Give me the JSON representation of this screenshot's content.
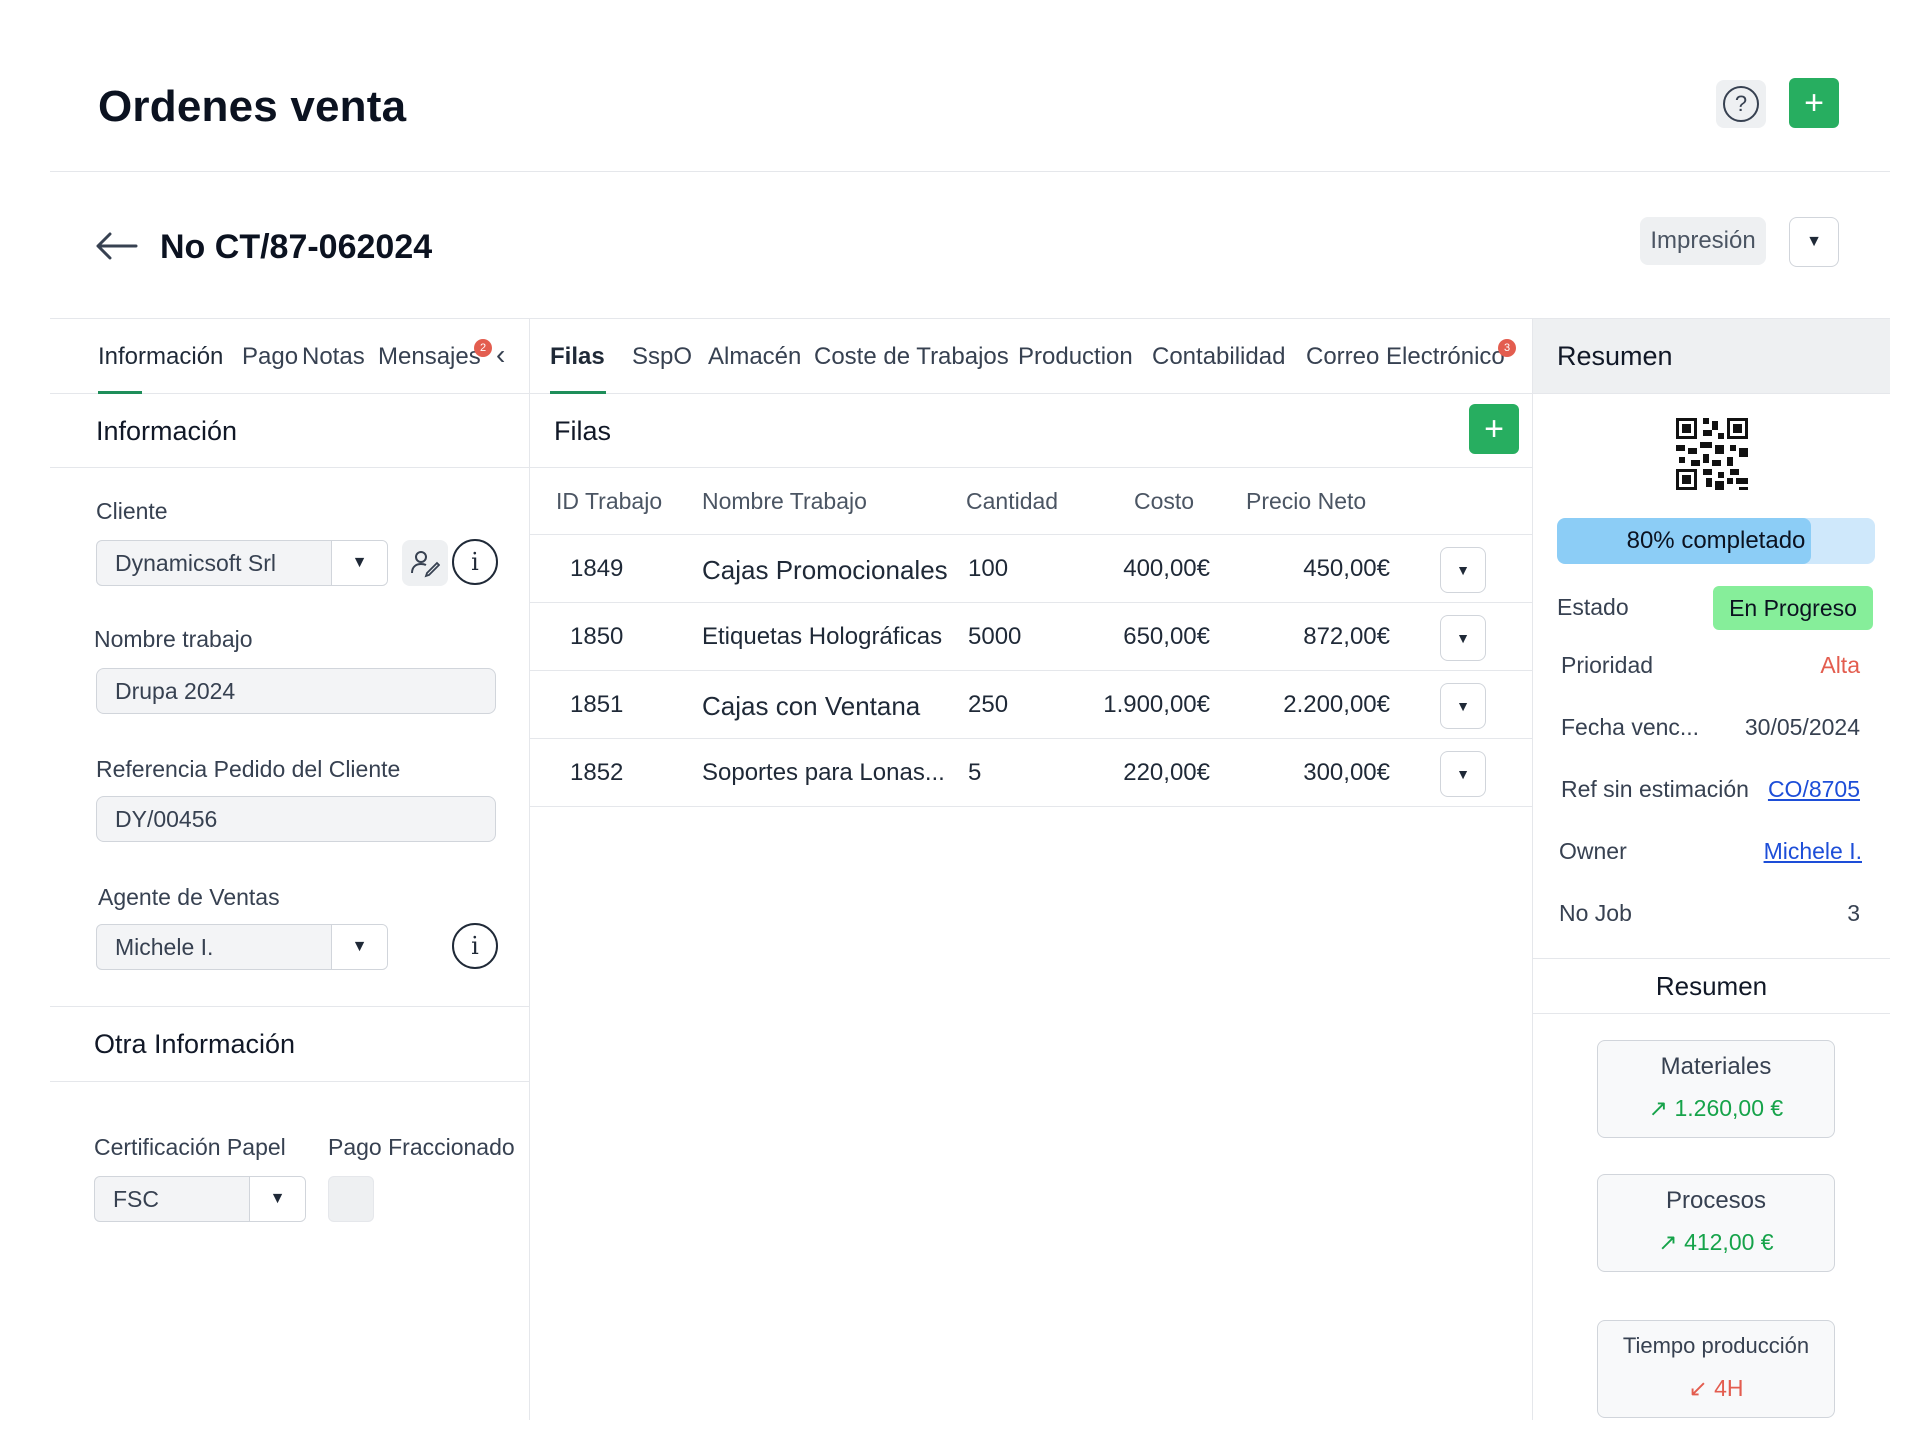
{
  "header": {
    "title": "Ordenes venta",
    "help_glyph": "?",
    "add_glyph": "+"
  },
  "order": {
    "number": "No CT/87-062024",
    "print_label": "Impresión"
  },
  "left_tabs": [
    {
      "label": "Información",
      "active": true
    },
    {
      "label": "Pago"
    },
    {
      "label": "Notas"
    },
    {
      "label": "Mensajes",
      "badge": "2"
    }
  ],
  "left": {
    "section_info": "Información",
    "cliente_label": "Cliente",
    "cliente_value": "Dynamicsoft Srl",
    "nombre_label": "Nombre trabajo",
    "nombre_value": "Drupa 2024",
    "ref_label": "Referencia Pedido del Cliente",
    "ref_value": "DY/00456",
    "agente_label": "Agente de Ventas",
    "agente_value": "Michele I.",
    "section_other": "Otra Información",
    "cert_label": "Certificación Papel",
    "cert_value": "FSC",
    "pago_label": "Pago Fraccionado",
    "info_glyph": "i"
  },
  "mid_tabs": [
    {
      "label": "Filas",
      "active": true
    },
    {
      "label": "SspO"
    },
    {
      "label": "Almacén"
    },
    {
      "label": "Coste de Trabajos"
    },
    {
      "label": "Production"
    },
    {
      "label": "Contabilidad"
    },
    {
      "label": "Correo Electrónico",
      "badge": "3"
    }
  ],
  "table": {
    "title": "Filas",
    "columns": [
      "ID Trabajo",
      "Nombre Trabajo",
      "Cantidad",
      "Costo",
      "Precio Neto"
    ],
    "rows": [
      {
        "id": "1849",
        "name": "Cajas Promocionales",
        "qty": "100",
        "cost": "400,00€",
        "net": "450,00€"
      },
      {
        "id": "1850",
        "name": "Etiquetas Holográficas",
        "qty": "5000",
        "cost": "650,00€",
        "net": "872,00€"
      },
      {
        "id": "1851",
        "name": "Cajas con Ventana",
        "qty": "250",
        "cost": "1.900,00€",
        "net": "2.200,00€"
      },
      {
        "id": "1852",
        "name": "Soportes para Lonas...",
        "qty": "5",
        "cost": "220,00€",
        "net": "300,00€"
      }
    ]
  },
  "right": {
    "title": "Resumen",
    "progress": {
      "percent": 80,
      "label": "80% completado"
    },
    "estado_label": "Estado",
    "estado_value": "En Progreso",
    "prioridad_label": "Prioridad",
    "prioridad_value": "Alta",
    "fecha_label": "Fecha venc...",
    "fecha_value": "30/05/2024",
    "ref_label": "Ref sin estimación",
    "ref_value": "CO/8705",
    "owner_label": "Owner",
    "owner_value": "Michele I.",
    "nojob_label": "No Job",
    "nojob_value": "3",
    "summary_title": "Resumen",
    "cards": [
      {
        "title": "Materiales",
        "arrow": "↗",
        "value": "1.260,00 €"
      },
      {
        "title": "Procesos",
        "arrow": "↗",
        "value": "412,00 €"
      },
      {
        "title": "Tiempo producción",
        "arrow": "↙",
        "value": "4H"
      }
    ]
  },
  "colors": {
    "accent_green": "#27ae60",
    "status_green": "#86ee9a",
    "alert_red": "#e35d4f",
    "progress_blue": "#8ccdf6",
    "link_blue": "#1d4ed8"
  }
}
